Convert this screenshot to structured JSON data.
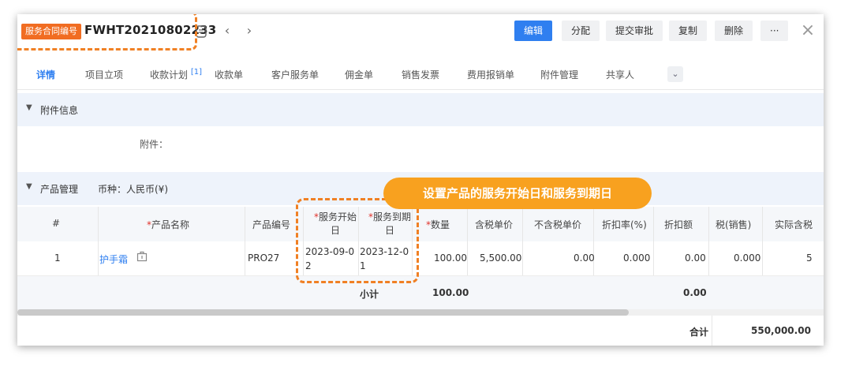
{
  "header": {
    "type_badge": "服务合同编号",
    "contract_no": "FWHT20210802233",
    "prev": "‹",
    "next": "›",
    "actions": {
      "edit": "编辑",
      "assign": "分配",
      "submit": "提交审批",
      "copy": "复制",
      "delete": "删除",
      "more": "···"
    },
    "close": "×"
  },
  "tabs": [
    {
      "label": "详情"
    },
    {
      "label": "项目立项"
    },
    {
      "label": "收款计划",
      "badge": "[1]"
    },
    {
      "label": "收款单"
    },
    {
      "label": "客户服务单"
    },
    {
      "label": "佣金单"
    },
    {
      "label": "销售发票"
    },
    {
      "label": "费用报销单"
    },
    {
      "label": "附件管理"
    },
    {
      "label": "共享人"
    }
  ],
  "tab_more": "⌄",
  "attachment_section": {
    "title": "附件信息",
    "field_label": "附件："
  },
  "product_section": {
    "title": "产品管理",
    "currency": "币种：人民币(¥)"
  },
  "columns": {
    "index": "#",
    "name": "产品名称",
    "code": "产品编号",
    "start_a": "服务开始",
    "start_b": "日",
    "end_a": "服务到期",
    "end_b": "日",
    "qty": "数量",
    "tax_price": "含税单价",
    "notax_price": "不含税单价",
    "discount_rate": "折扣率(%)",
    "discount_amt": "折扣额",
    "tax": "税(销售)",
    "actual": "实际含税"
  },
  "row": {
    "index": "1",
    "name": "护手霜",
    "code": "PRO27",
    "start_a": "2023-09-0",
    "start_b": "2",
    "end_a": "2023-12-0",
    "end_b": "1",
    "qty": "100.00",
    "tax_price": "5,500.00",
    "notax_price": "0.00",
    "discount_rate": "0.000",
    "discount_amt": "0.00",
    "tax": "0.000",
    "actual": "5"
  },
  "subtotal": {
    "label": "小计",
    "qty": "100.00",
    "discount_amt": "0.00"
  },
  "total": {
    "label": "合计",
    "value": "550,000.00"
  },
  "callout": "设置产品的服务开始日和服务到期日",
  "colors": {
    "primary": "#2f7ff0",
    "accent": "#f08024",
    "badge": "#f16d22",
    "callout": "#f8a11f"
  }
}
